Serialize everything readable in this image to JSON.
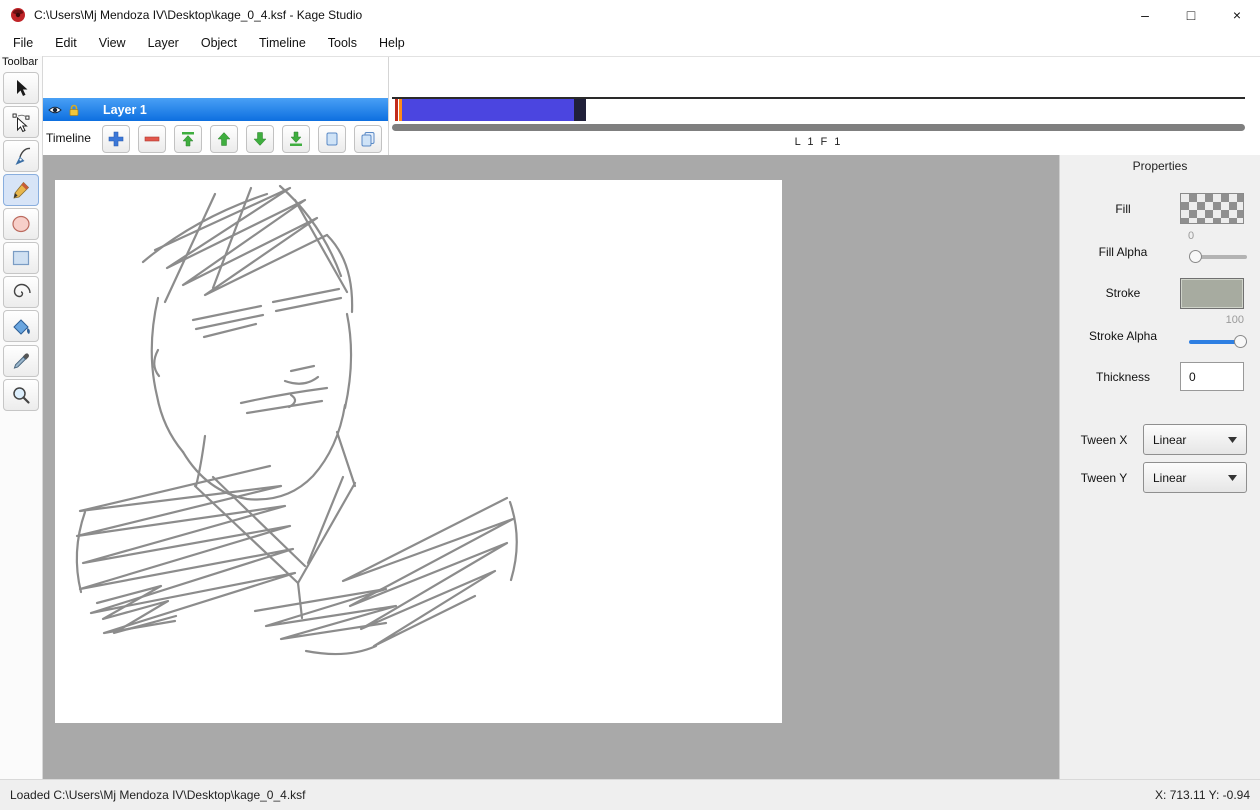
{
  "window": {
    "title": "C:\\Users\\Mj Mendoza IV\\Desktop\\kage_0_4.ksf - Kage Studio",
    "minimize": "–",
    "maximize": "□",
    "close": "×"
  },
  "menu": {
    "items": [
      "File",
      "Edit",
      "View",
      "Layer",
      "Object",
      "Timeline",
      "Tools",
      "Help"
    ]
  },
  "toolbar": {
    "label": "Toolbar",
    "tools": [
      "select",
      "node-edit",
      "pen",
      "pencil",
      "oval",
      "rectangle",
      "spiral",
      "paint-bucket",
      "eyedropper",
      "zoom"
    ],
    "active_tool": "pencil"
  },
  "layers": {
    "items": [
      {
        "name": "Layer 1",
        "visible": true,
        "locked": true
      }
    ]
  },
  "timeline": {
    "label": "Timeline",
    "position_label": "L 1 F 1",
    "buttons": [
      "add-frame",
      "remove-frame",
      "move-to-top",
      "move-up",
      "move-down",
      "move-to-bottom",
      "copy-frame",
      "paste-frame"
    ],
    "track_color": "#4b45e0"
  },
  "properties": {
    "title": "Properties",
    "fill": {
      "label": "Fill"
    },
    "fill_alpha": {
      "label": "Fill Alpha",
      "value": "0"
    },
    "stroke": {
      "label": "Stroke",
      "color": "#a7aba0"
    },
    "stroke_alpha": {
      "label": "Stroke Alpha",
      "value": "100",
      "accent": "#2e7fe2"
    },
    "thickness": {
      "label": "Thickness",
      "value": "0"
    },
    "tween_x": {
      "label": "Tween X",
      "value": "Linear"
    },
    "tween_y": {
      "label": "Tween Y",
      "value": "Linear"
    }
  },
  "statusbar": {
    "message": "Loaded C:\\Users\\Mj Mendoza IV\\Desktop\\kage_0_4.ksf",
    "coords": "X: 713.11 Y: -0.94"
  }
}
